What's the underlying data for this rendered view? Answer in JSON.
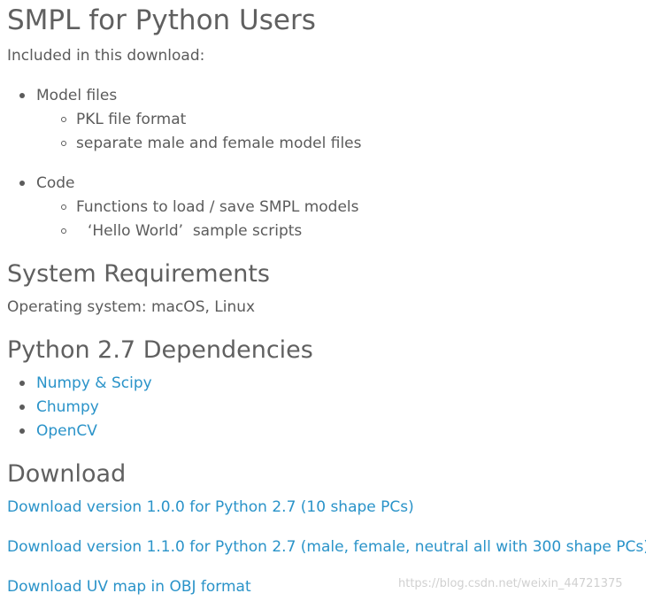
{
  "title": "SMPL for Python Users",
  "intro": "Included in this download:",
  "included": [
    {
      "label": "Model files",
      "children": [
        "PKL file format",
        "separate male and female model files"
      ]
    },
    {
      "label": "Code",
      "children": [
        "Functions to load / save SMPL models",
        "‘Hello World’  sample scripts"
      ]
    }
  ],
  "system_requirements": {
    "heading": "System Requirements",
    "text": "Operating system: macOS, Linux"
  },
  "dependencies": {
    "heading": "Python 2.7 Dependencies",
    "items": [
      "Numpy & Scipy",
      "Chumpy",
      "OpenCV"
    ]
  },
  "download": {
    "heading": "Download",
    "links": [
      "Download version 1.0.0 for Python 2.7 (10 shape PCs)",
      "Download version 1.1.0 for Python 2.7 (male, female, neutral all with 300 shape PCs)",
      "Download UV map in OBJ format"
    ]
  },
  "watermark": "https://blog.csdn.net/weixin_44721375",
  "colors": {
    "text": "#5b5b5b",
    "heading": "#606060",
    "link": "#2a93c9",
    "watermark": "#d0d0d0"
  }
}
